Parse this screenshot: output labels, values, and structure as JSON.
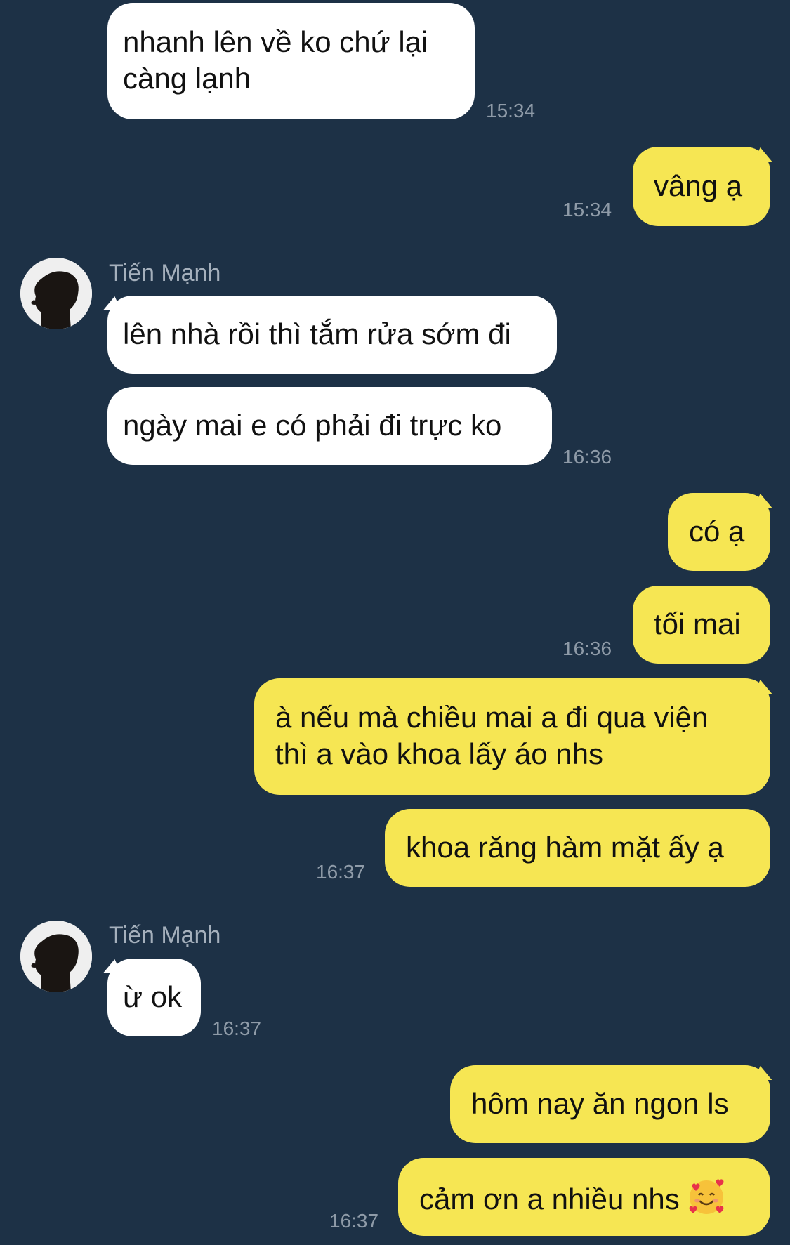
{
  "conversation": {
    "messages": [
      {
        "text_lines": [
          "nhanh lên về ko chứ lại",
          "càng lạnh"
        ],
        "time": "15:34"
      },
      {
        "text": "vâng ạ",
        "time": "15:34"
      },
      {
        "sender": "Tiến Mạnh",
        "text": "lên nhà rồi thì tắm rửa sớm đi"
      },
      {
        "text": "ngày mai e có phải đi trực ko",
        "time": "16:36"
      },
      {
        "text": "có ạ"
      },
      {
        "text": "tối mai",
        "time": "16:36"
      },
      {
        "text_lines": [
          "à nếu mà chiều mai a đi qua viện",
          "thì a vào khoa lấy áo nhs"
        ]
      },
      {
        "text": "khoa răng hàm mặt ấy ạ",
        "time": "16:37"
      },
      {
        "sender": "Tiến Mạnh",
        "text": "ừ ok",
        "time": "16:37"
      },
      {
        "text": "hôm nay ăn ngon ls"
      },
      {
        "text": "cảm ơn a nhiều nhs",
        "emoji": "smiling-face-with-hearts",
        "time": "16:37"
      }
    ]
  },
  "colors": {
    "background": "#1d3146",
    "incoming_bubble": "#ffffff",
    "outgoing_bubble": "#f6e653",
    "timestamp": "#8f9ba8",
    "sender_name": "#a5b0bc"
  }
}
